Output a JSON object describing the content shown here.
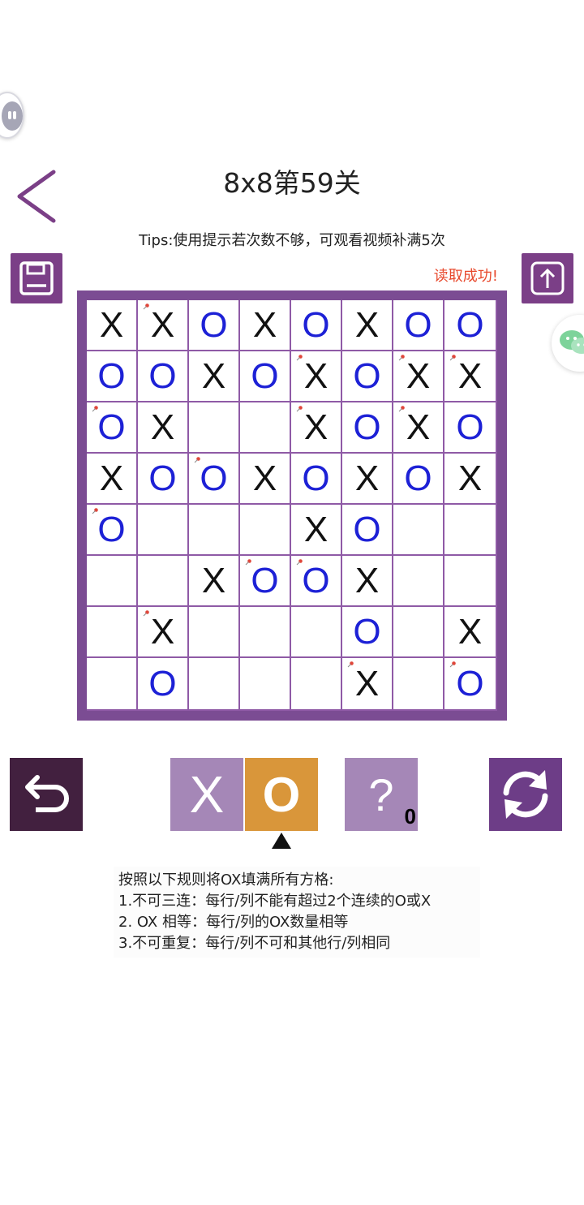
{
  "header": {
    "title": "8x8第59关",
    "tips": "Tips:使用提示若次数不够，可观看视频补满5次",
    "status": "读取成功!"
  },
  "colors": {
    "purple": "#7b3f87",
    "board": "#7b4c93",
    "x_color": "#111111",
    "o_color": "#1d21d6",
    "o_selected": "#d9963a",
    "status_red": "#e84a2e"
  },
  "icons": {
    "back": "back-chevron-icon",
    "save": "floppy-disk-icon",
    "export": "upload-arrow-icon",
    "undo": "undo-arrow-icon",
    "refresh": "refresh-cycle-icon",
    "pin": "pin-marker-icon",
    "wechat": "wechat-icon"
  },
  "board": {
    "rows": [
      [
        "X",
        "X",
        "O",
        "X",
        "O",
        "X",
        "O",
        "O"
      ],
      [
        "O",
        "O",
        "X",
        "O",
        "X",
        "O",
        "X",
        "X"
      ],
      [
        "O",
        "X",
        "",
        "",
        "X",
        "O",
        "X",
        "O"
      ],
      [
        "X",
        "O",
        "O",
        "X",
        "O",
        "X",
        "O",
        "X"
      ],
      [
        "O",
        "",
        "",
        "",
        "X",
        "O",
        "",
        ""
      ],
      [
        "",
        "",
        "X",
        "O",
        "O",
        "X",
        "",
        ""
      ],
      [
        "",
        "X",
        "",
        "",
        "",
        "O",
        "",
        "X"
      ],
      [
        "",
        "O",
        "",
        "",
        "",
        "X",
        "",
        "O"
      ]
    ],
    "pinned": [
      [
        0,
        1
      ],
      [
        1,
        4
      ],
      [
        1,
        6
      ],
      [
        1,
        7
      ],
      [
        2,
        0
      ],
      [
        2,
        4
      ],
      [
        2,
        6
      ],
      [
        3,
        2
      ],
      [
        4,
        0
      ],
      [
        5,
        3
      ],
      [
        5,
        4
      ],
      [
        6,
        1
      ],
      [
        7,
        5
      ],
      [
        7,
        7
      ]
    ]
  },
  "controls": {
    "pick_x": "X",
    "pick_o": "O",
    "selected": "O",
    "hint_label": "?",
    "hint_count": "0"
  },
  "rules": [
    "按照以下规则将OX填满所有方格:",
    "1.不可三连：每行/列不能有超过2个连续的O或X",
    "2. OX 相等：每行/列的OX数量相等",
    "3.不可重复：每行/列不可和其他行/列相同"
  ]
}
